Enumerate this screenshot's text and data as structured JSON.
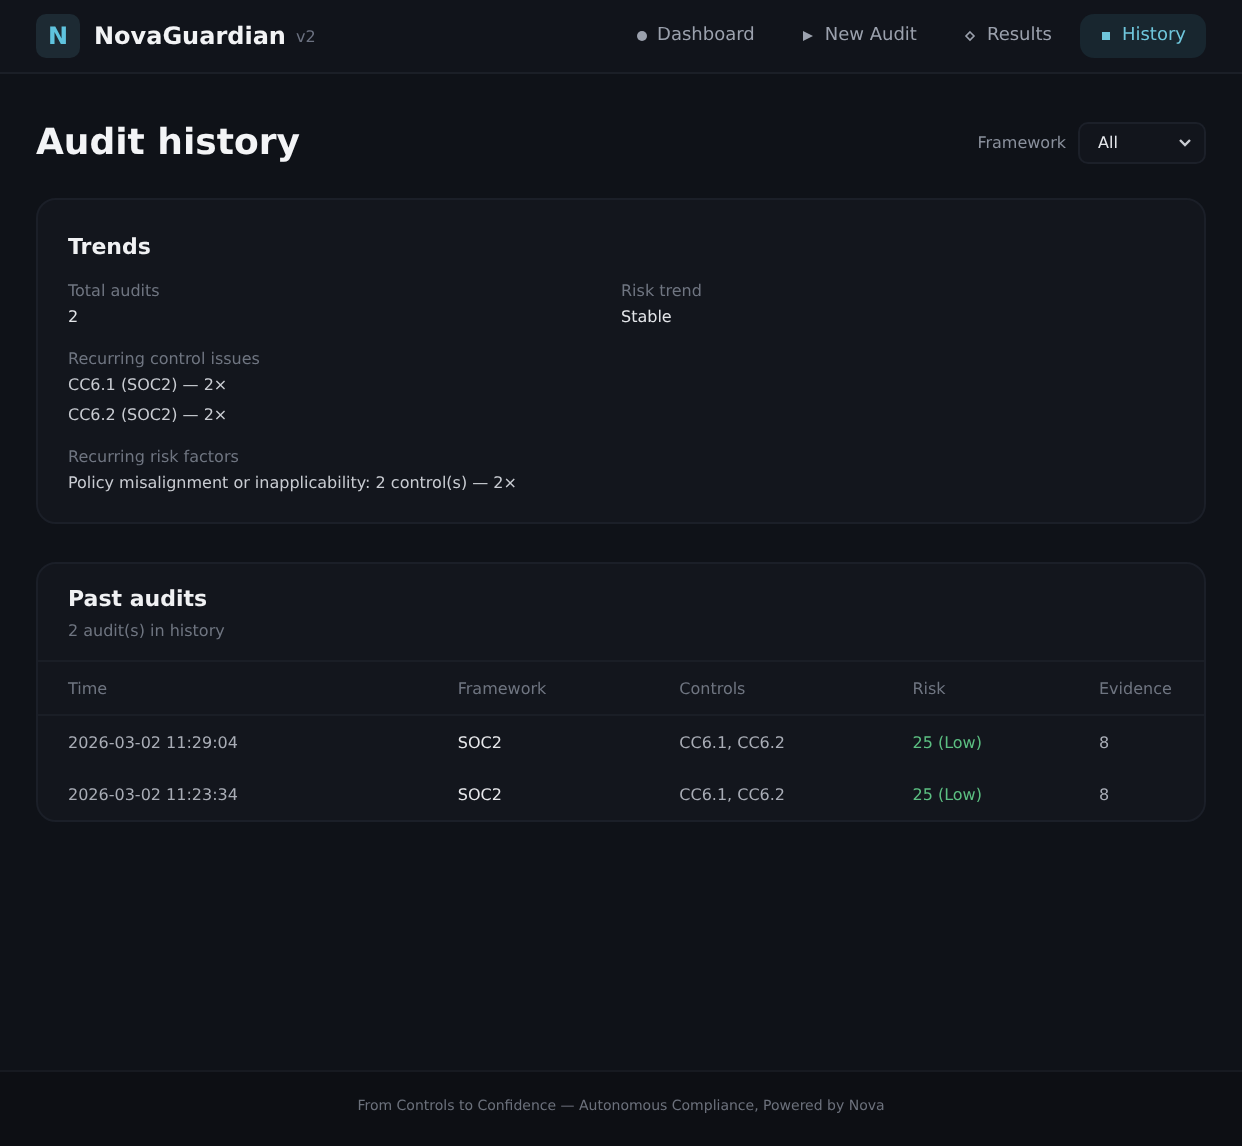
{
  "app": {
    "logo_letter": "N",
    "name": "NovaGuardian",
    "version": "v2"
  },
  "nav": [
    {
      "label": "Dashboard",
      "selected": false
    },
    {
      "label": "New Audit",
      "selected": false
    },
    {
      "label": "Results",
      "selected": false
    },
    {
      "label": "History",
      "selected": true
    }
  ],
  "page": {
    "title": "Audit history",
    "filter": {
      "label": "Framework",
      "value": "All"
    }
  },
  "trends": {
    "title": "Trends",
    "stats": [
      {
        "label": "Total audits",
        "value": "2"
      },
      {
        "label": "Risk trend",
        "value": "Stable"
      }
    ],
    "sections": [
      {
        "label": "Recurring control issues",
        "items": [
          "CC6.1 (SOC2) — 2×",
          "CC6.2 (SOC2) — 2×"
        ]
      },
      {
        "label": "Recurring risk factors",
        "items": [
          "Policy misalignment or inapplicability: 2 control(s) — 2×"
        ]
      }
    ]
  },
  "past_audits": {
    "title": "Past audits",
    "subtitle": "2 audit(s) in history",
    "columns": [
      "Time",
      "Framework",
      "Controls",
      "Risk",
      "Evidence"
    ],
    "rows": [
      {
        "time": "2026-03-02 11:29:04",
        "framework": "SOC2",
        "controls": "CC6.1, CC6.2",
        "risk": "25 (Low)",
        "color": "#5cbf82",
        "evidence": "8"
      },
      {
        "time": "2026-03-02 11:23:34",
        "framework": "SOC2",
        "controls": "CC6.1, CC6.2",
        "risk": "25 (Low)",
        "color": "#5cbf82",
        "evidence": "8"
      }
    ]
  },
  "footer": "From Controls to Confidence — Autonomous Compliance, Powered by Nova"
}
